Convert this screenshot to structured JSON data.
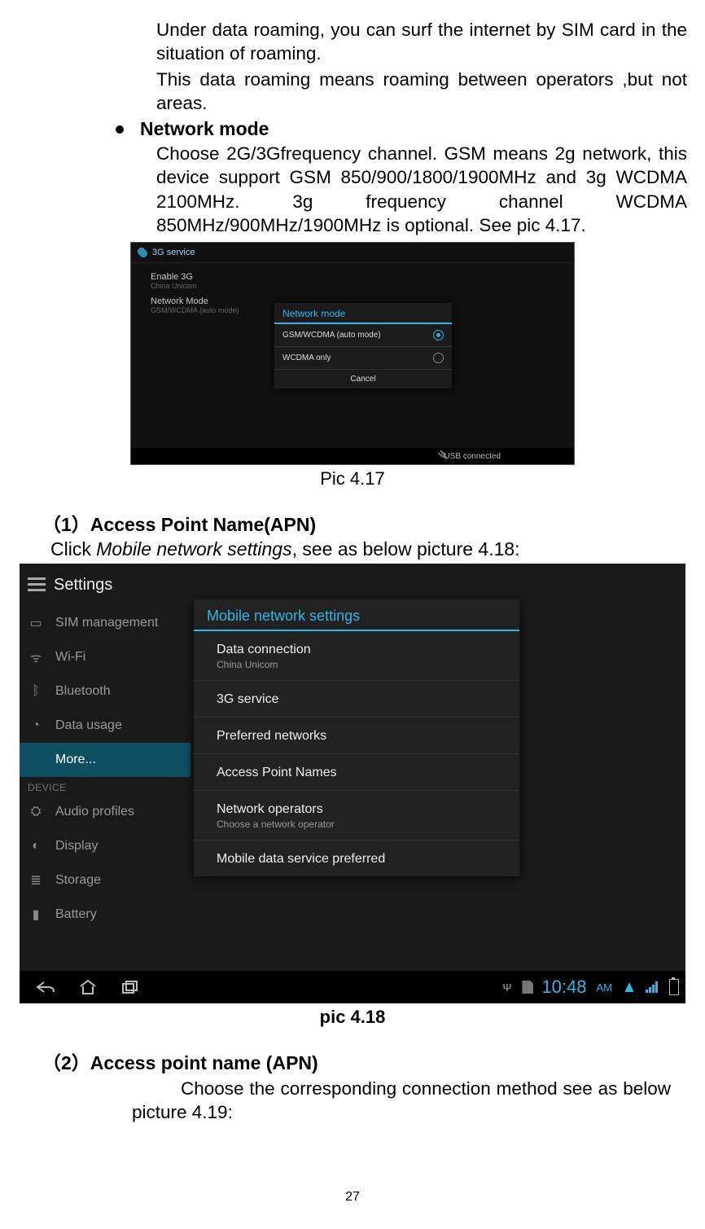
{
  "doc": {
    "p1": "Under data roaming, you can surf the internet by SIM card in the situation of roaming.",
    "p2": "This data roaming means roaming between operators ,but not areas.",
    "bullet": "Network mode",
    "p3": "Choose 2G/3Gfrequency channel. GSM means 2g network, this device support GSM 850/900/1800/1900MHz and 3g WCDMA 2100MHz. 3g frequency channel WCDMA 850MHz/900MHz/1900MHz is optional. See pic 4.17.",
    "cap417": "Pic 4.17",
    "sec1": "（1）Access Point Name(APN)",
    "sec1_line_a": "Click ",
    "sec1_line_b": "Mobile network settings",
    "sec1_line_c": ", see as below picture 4.18:",
    "cap418": "pic 4.18",
    "sec2": "（2）Access point name (APN)",
    "sec2_body": "Choose the corresponding connection method see as below picture 4.19:",
    "pagenum": "27"
  },
  "s417": {
    "title": "3G service",
    "bg_enable": "Enable 3G",
    "bg_enable_sub": "China Unicom",
    "bg_mode": "Network Mode",
    "bg_mode_sub": "GSM/WCDMA (auto mode)",
    "dialog_title": "Network mode",
    "opt_auto": "GSM/WCDMA (auto mode)",
    "opt_wcdma": "WCDMA only",
    "cancel": "Cancel",
    "usb": "USB connected"
  },
  "s418": {
    "title": "Settings",
    "side": {
      "sim": "SIM management",
      "wifi": "Wi-Fi",
      "bt": "Bluetooth",
      "data": "Data usage",
      "more": "More...",
      "device": "DEVICE",
      "audio": "Audio profiles",
      "display": "Display",
      "storage": "Storage",
      "battery": "Battery"
    },
    "panel": {
      "title": "Mobile network settings",
      "data": "Data connection",
      "data_sub": "China Unicom",
      "g3": "3G service",
      "pref": "Preferred networks",
      "apn": "Access Point Names",
      "ops": "Network operators",
      "ops_sub": "Choose a network operator",
      "mds": "Mobile data service preferred"
    },
    "status": {
      "time": "10:48",
      "ampm": "AM"
    }
  }
}
